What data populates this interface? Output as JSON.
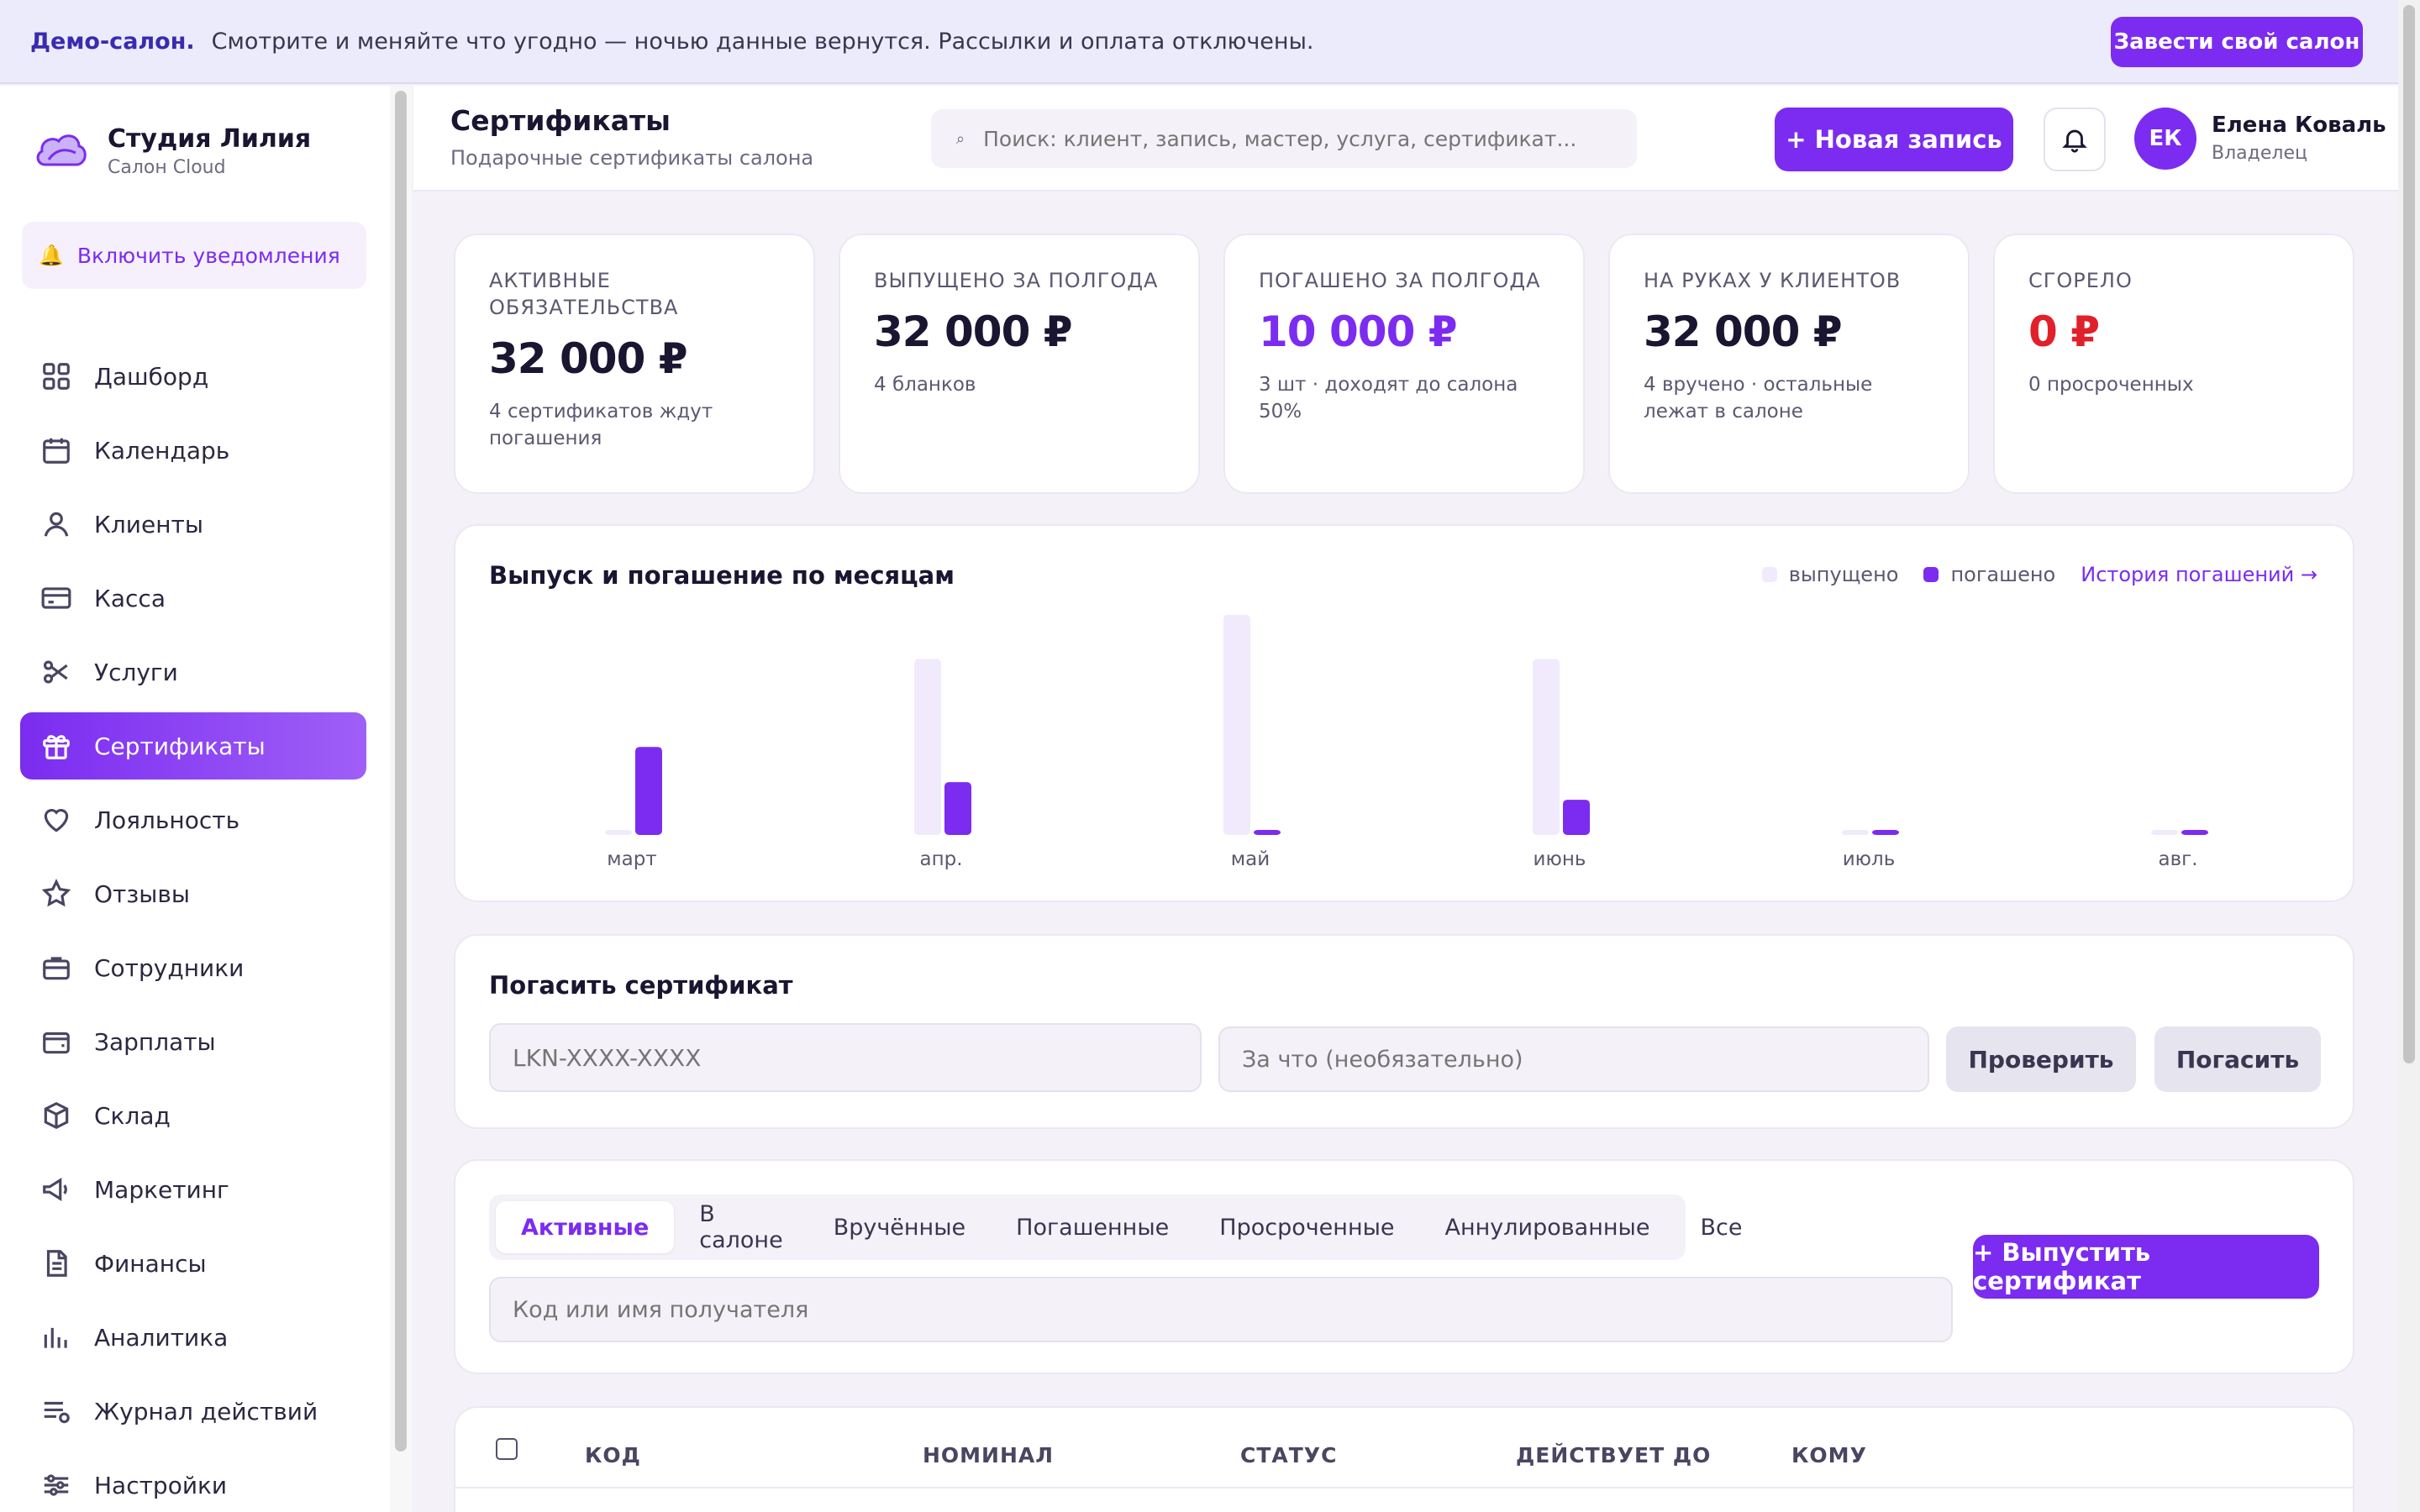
{
  "banner": {
    "strong": "Демо-салон.",
    "text": "Смотрите и меняйте что угодно — ночью данные вернутся. Рассылки и оплата отключены.",
    "button": "Завести свой салон"
  },
  "sidebar": {
    "brand_name": "Студия Лилия",
    "brand_sub": "Салон Cloud",
    "notifications": "Включить уведомления",
    "items": [
      {
        "label": "Дашборд",
        "icon": "grid-icon"
      },
      {
        "label": "Календарь",
        "icon": "calendar-icon"
      },
      {
        "label": "Клиенты",
        "icon": "user-icon"
      },
      {
        "label": "Касса",
        "icon": "card-icon"
      },
      {
        "label": "Услуги",
        "icon": "scissors-icon"
      },
      {
        "label": "Сертификаты",
        "icon": "gift-icon",
        "active": true
      },
      {
        "label": "Лояльность",
        "icon": "heart-icon"
      },
      {
        "label": "Отзывы",
        "icon": "star-icon"
      },
      {
        "label": "Сотрудники",
        "icon": "briefcase-icon"
      },
      {
        "label": "Зарплаты",
        "icon": "wallet-icon"
      },
      {
        "label": "Склад",
        "icon": "box-icon"
      },
      {
        "label": "Маркетинг",
        "icon": "megaphone-icon"
      },
      {
        "label": "Финансы",
        "icon": "document-icon"
      },
      {
        "label": "Аналитика",
        "icon": "bar-chart-icon"
      },
      {
        "label": "Журнал действий",
        "icon": "list-icon"
      },
      {
        "label": "Настройки",
        "icon": "sliders-icon"
      }
    ]
  },
  "header": {
    "title": "Сертификаты",
    "subtitle": "Подарочные сертификаты салона",
    "search_placeholder": "Поиск: клиент, запись, мастер, услуга, сертификат...",
    "new_button": "+ Новая запись",
    "user_initials": "ЕК",
    "user_name": "Елена Коваль",
    "user_role": "Владелец"
  },
  "stats": [
    {
      "label": "АКТИВНЫЕ ОБЯЗАТЕЛЬСТВА",
      "value": "32 000 ₽",
      "note": "4 сертификатов ждут погашения",
      "tone": "dark"
    },
    {
      "label": "ВЫПУЩЕНО ЗА ПОЛГОДА",
      "value": "32 000 ₽",
      "note": "4 бланков",
      "tone": "dark"
    },
    {
      "label": "ПОГАШЕНО ЗА ПОЛГОДА",
      "value": "10 000 ₽",
      "note": "3 шт · доходят до салона 50%",
      "tone": "purple"
    },
    {
      "label": "НА РУКАХ У КЛИЕНТОВ",
      "value": "32 000 ₽",
      "note": "4 вручено · остальные лежат в салоне",
      "tone": "dark"
    },
    {
      "label": "СГОРЕЛО",
      "value": "0 ₽",
      "note": "0 просроченных",
      "tone": "red"
    }
  ],
  "chart": {
    "title": "Выпуск и погашение по месяцам",
    "legend_issued": "выпущено",
    "legend_redeemed": "погашено",
    "history_link": "История погашений →",
    "colors": {
      "issued": "#f1eafc",
      "redeemed": "#7b2cf0"
    }
  },
  "chart_data": {
    "type": "bar",
    "title": "Выпуск и погашение по месяцам",
    "categories": [
      "март",
      "апр.",
      "май",
      "июнь",
      "июль",
      "авг."
    ],
    "series": [
      {
        "name": "выпущено",
        "values": [
          0,
          8000,
          10000,
          8000,
          0,
          0
        ]
      },
      {
        "name": "погашено",
        "values": [
          4000,
          2400,
          200,
          1600,
          200,
          200
        ]
      }
    ],
    "ylim": [
      0,
      10000
    ],
    "grid": false,
    "legend": "top-right"
  },
  "redeem": {
    "title": "Погасить сертификат",
    "code_placeholder": "LKN-XXXX-XXXX",
    "reason_placeholder": "За что (необязательно)",
    "check_button": "Проверить",
    "redeem_button": "Погасить"
  },
  "filters": {
    "tabs": [
      "Активные",
      "В салоне",
      "Вручённые",
      "Погашенные",
      "Просроченные",
      "Аннулированные",
      "Все"
    ],
    "active_tab": "Активные",
    "search_placeholder": "Код или имя получателя",
    "issue_button": "+ Выпустить сертификат"
  },
  "table": {
    "headers": [
      "КОД",
      "НОМИНАЛ",
      "СТАТУС",
      "ДЕЙСТВУЕТ ДО",
      "КОМУ"
    ]
  }
}
